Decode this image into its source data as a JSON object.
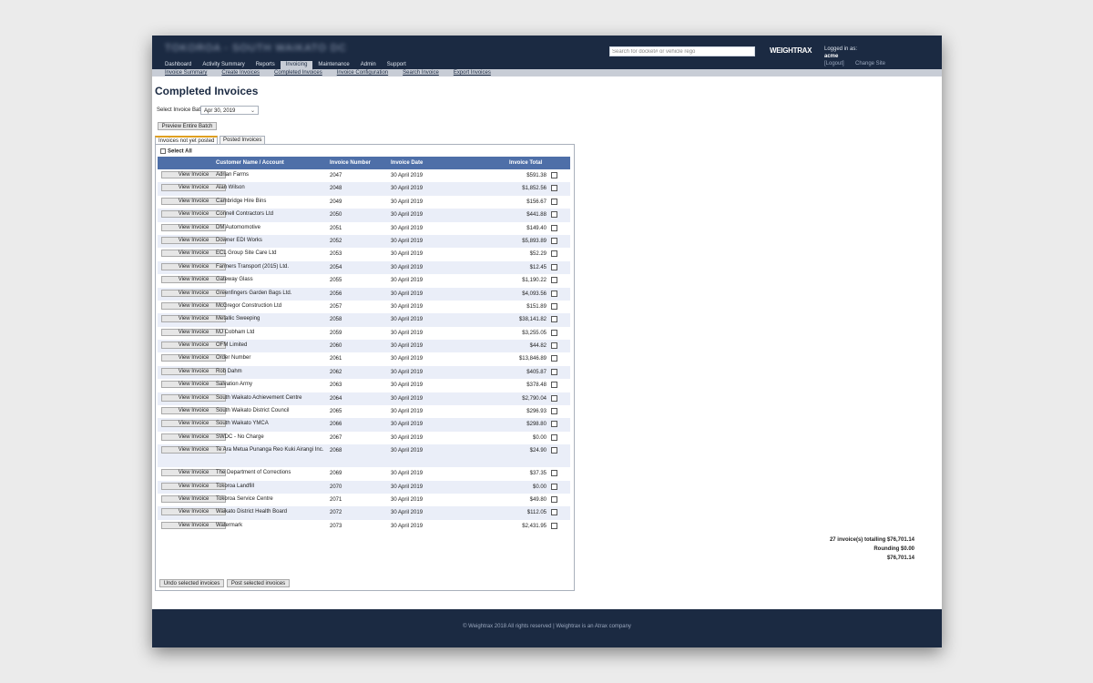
{
  "header": {
    "site_title": "TOKOROA - SOUTH WAIKATO DC",
    "search_placeholder": "Search for docket# or vehicle rego",
    "logo": "WEIGHTRAX",
    "logged_in_label": "Logged in as:",
    "user": "acme",
    "logout": "[Logout]",
    "change_site": "Change Site"
  },
  "main_tabs": [
    {
      "label": "Dashboard"
    },
    {
      "label": "Activity Summary"
    },
    {
      "label": "Reports"
    },
    {
      "label": "Invoicing"
    },
    {
      "label": "Maintenance"
    },
    {
      "label": "Admin"
    },
    {
      "label": "Support"
    }
  ],
  "active_main_tab": "Invoicing",
  "sub_nav": [
    {
      "label": "Invoice Summary"
    },
    {
      "label": "Create Invoices"
    },
    {
      "label": "Completed Invoices"
    },
    {
      "label": "Invoice Configuration"
    },
    {
      "label": "Search Invoice"
    },
    {
      "label": "Export Invoices"
    }
  ],
  "page": {
    "title": "Completed Invoices",
    "batch_label": "Select Invoice Batch:",
    "batch_value": "Apr 30, 2019",
    "preview_button": "Preview Entire Batch",
    "tab_not_posted": "Invoices not yet posted",
    "tab_posted": "Posted Invoices",
    "select_all": "Select All",
    "view_button": "View Invoice",
    "undo_button": "Undo selected invoices",
    "post_button": "Post selected invoices"
  },
  "table": {
    "headers": {
      "customer": "Customer Name / Account",
      "number": "Invoice Number",
      "date": "Invoice Date",
      "total": "Invoice Total"
    },
    "rows": [
      {
        "customer": "Adrian Farms",
        "number": "2047",
        "date": "30 April 2019",
        "total": "$591.38"
      },
      {
        "customer": "Alan Wilson",
        "number": "2048",
        "date": "30 April 2019",
        "total": "$1,852.56"
      },
      {
        "customer": "Cambridge Hire Bins",
        "number": "2049",
        "date": "30 April 2019",
        "total": "$156.67"
      },
      {
        "customer": "Connell Contractors Ltd",
        "number": "2050",
        "date": "30 April 2019",
        "total": "$441.88"
      },
      {
        "customer": "DM Automomotive",
        "number": "2051",
        "date": "30 April 2019",
        "total": "$149.40"
      },
      {
        "customer": "Downer EDI Works",
        "number": "2052",
        "date": "30 April 2019",
        "total": "$5,893.89"
      },
      {
        "customer": "ECL Group Site Care Ltd",
        "number": "2053",
        "date": "30 April 2019",
        "total": "$52.29"
      },
      {
        "customer": "Farmers Transport (2015) Ltd.",
        "number": "2054",
        "date": "30 April 2019",
        "total": "$12.45"
      },
      {
        "customer": "Gateway Glass",
        "number": "2055",
        "date": "30 April 2019",
        "total": "$1,190.22"
      },
      {
        "customer": "Greenfingers Garden Bags Ltd.",
        "number": "2056",
        "date": "30 April 2019",
        "total": "$4,093.56"
      },
      {
        "customer": "McGregor Construction Ltd",
        "number": "2057",
        "date": "30 April 2019",
        "total": "$151.89"
      },
      {
        "customer": "Metallic Sweeping",
        "number": "2058",
        "date": "30 April 2019",
        "total": "$38,141.82"
      },
      {
        "customer": "MJ Cobham Ltd",
        "number": "2059",
        "date": "30 April 2019",
        "total": "$3,255.05"
      },
      {
        "customer": "OFM Limited",
        "number": "2060",
        "date": "30 April 2019",
        "total": "$44.82"
      },
      {
        "customer": "Order Number",
        "number": "2061",
        "date": "30 April 2019",
        "total": "$13,846.89"
      },
      {
        "customer": "Rob Dahm",
        "number": "2062",
        "date": "30 April 2019",
        "total": "$405.87"
      },
      {
        "customer": "Salvation Army",
        "number": "2063",
        "date": "30 April 2019",
        "total": "$378.48"
      },
      {
        "customer": "South Waikato Achievement Centre",
        "number": "2064",
        "date": "30 April 2019",
        "total": "$2,790.04"
      },
      {
        "customer": "South Waikato District Council",
        "number": "2065",
        "date": "30 April 2019",
        "total": "$296.93"
      },
      {
        "customer": "South Waikato YMCA",
        "number": "2066",
        "date": "30 April 2019",
        "total": "$298.80"
      },
      {
        "customer": "SWDC - No Charge",
        "number": "2067",
        "date": "30 April 2019",
        "total": "$0.00"
      },
      {
        "customer": "Te Ara Metua Punanga Reo Kuki Airangi Inc.",
        "number": "2068",
        "date": "30 April 2019",
        "total": "$24.90"
      },
      {
        "customer": "The Department of Corrections",
        "number": "2069",
        "date": "30 April 2019",
        "total": "$37.35"
      },
      {
        "customer": "Tokoroa Landfill",
        "number": "2070",
        "date": "30 April 2019",
        "total": "$0.00"
      },
      {
        "customer": "Tokoroa Service Centre",
        "number": "2071",
        "date": "30 April 2019",
        "total": "$49.80"
      },
      {
        "customer": "Waikato District Health Board",
        "number": "2072",
        "date": "30 April 2019",
        "total": "$112.05"
      },
      {
        "customer": "Watermark",
        "number": "2073",
        "date": "30 April 2019",
        "total": "$2,431.95"
      }
    ]
  },
  "summary": {
    "count_line": "27 invoice(s) totalling $76,701.14",
    "rounding_line": "Rounding $0.00",
    "grand_total": "$76,701.14"
  },
  "footer": {
    "text": "© Weightrax 2018 All rights reserved | Weightrax is an Atrax company"
  }
}
